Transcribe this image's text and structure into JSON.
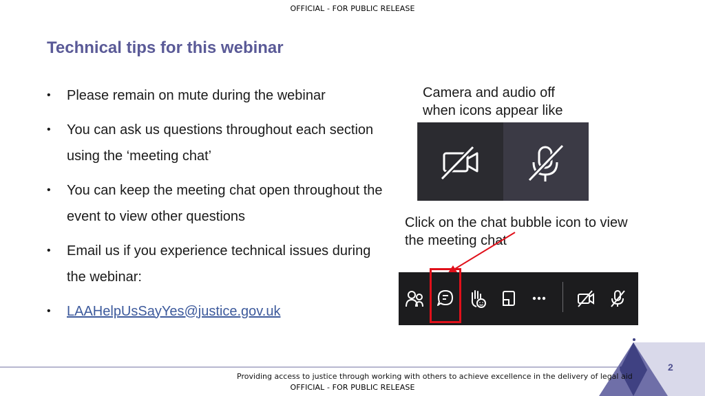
{
  "header": {
    "marking": "OFFICIAL - FOR PUBLIC RELEASE"
  },
  "title": "Technical tips for this webinar",
  "bullets": [
    "Please remain on mute during the webinar",
    "You can ask us questions throughout each section using the ‘meeting chat’",
    "You can keep the meeting chat open throughout the event to view other questions",
    "Email us if you experience technical issues during the webinar:"
  ],
  "email": "LAAHelpUsSayYes@justice.gov.uk",
  "captions": {
    "camera_audio": "Camera and audio off when icons appear like this",
    "chat_bubble": "Click on the chat bubble icon to view the meeting chat"
  },
  "icons": {
    "av_panel": [
      "camera-off-icon",
      "mic-off-icon"
    ],
    "toolbar": [
      "people-icon",
      "chat-bubble-icon",
      "raise-hand-icon",
      "share-screen-icon",
      "more-options-icon",
      "camera-off-icon",
      "mic-off-icon"
    ]
  },
  "colors": {
    "title": "#5a5a97",
    "highlight": "#e0101a",
    "link": "#3d5a9c",
    "toolbar_bg": "#1c1c1e"
  },
  "footer": {
    "text": "Providing access to justice through working with others to achieve excellence in the delivery of legal aid",
    "marking": "OFFICIAL - FOR PUBLIC RELEASE",
    "page_number": "2"
  }
}
